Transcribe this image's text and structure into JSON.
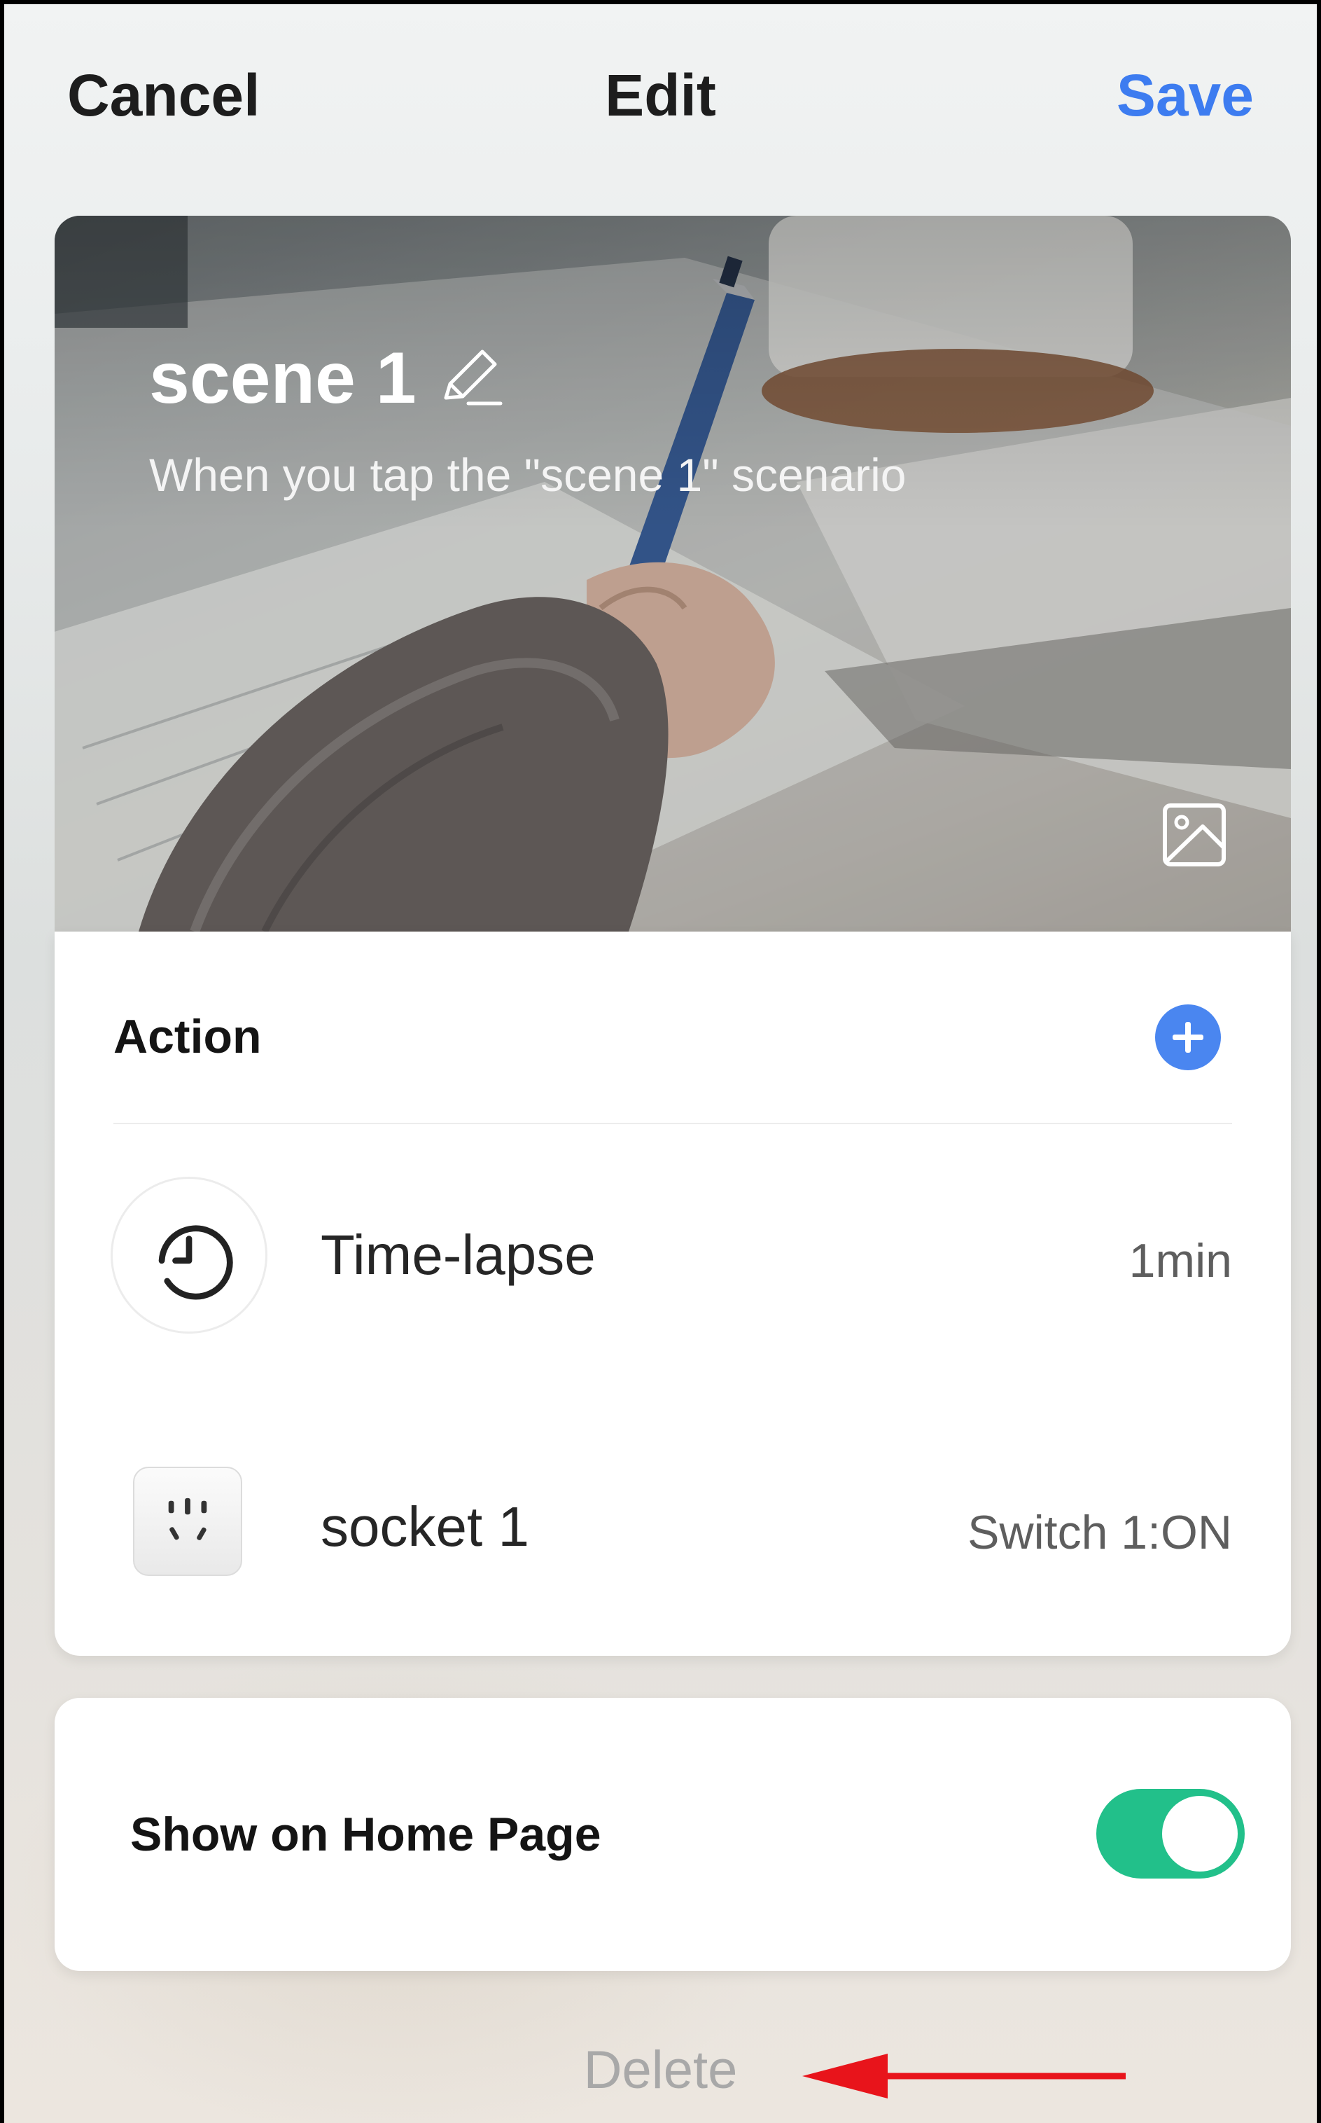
{
  "header": {
    "cancel_label": "Cancel",
    "title": "Edit",
    "save_label": "Save"
  },
  "cover": {
    "scene_name": "scene 1",
    "description": "When you tap the \"scene 1\" scenario",
    "edit_icon": "pencil-icon",
    "change_image_icon": "image-icon"
  },
  "actions": {
    "section_title": "Action",
    "add_icon": "plus-icon",
    "items": [
      {
        "label": "Time-lapse",
        "value": "1min",
        "icon": "clock-icon"
      },
      {
        "label": "socket 1",
        "value": "Switch 1:ON",
        "icon": "socket-icon"
      }
    ]
  },
  "home_page": {
    "label": "Show on Home Page",
    "enabled": true
  },
  "footer": {
    "delete_label": "Delete"
  },
  "colors": {
    "accent_blue": "#3d7cf0",
    "toggle_green": "#22c08a",
    "annotation_arrow_red": "#e8141b"
  }
}
